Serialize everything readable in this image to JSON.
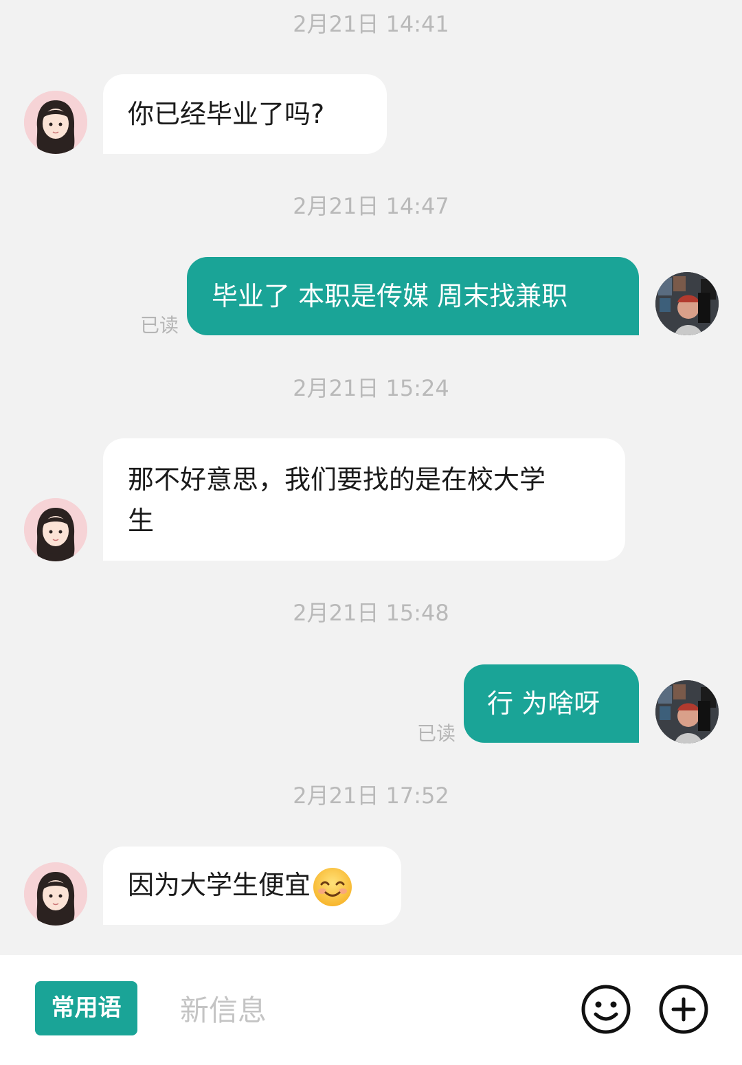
{
  "messages": [
    {
      "time": "2月21日 14:41",
      "text": "你已经毕业了吗?"
    },
    {
      "time": "2月21日 14:47",
      "text": "毕业了  本职是传媒  周末找兼职",
      "status": "已读"
    },
    {
      "time": "2月21日 15:24",
      "text_line1": "那不好意思，我们要找的是在校大学",
      "text_line2": "生"
    },
    {
      "time": "2月21日 15:48",
      "text": "行  为啥呀",
      "status": "已读"
    },
    {
      "time": "2月21日 17:52",
      "text": "因为大学生便宜",
      "emoji": "smiling-face-emoji"
    }
  ],
  "composer": {
    "phrase_label": "常用语",
    "placeholder": "新信息",
    "emoji_icon": "smiley-icon",
    "add_icon": "plus-circle-icon"
  },
  "colors": {
    "accent": "#1aa497",
    "background": "#f2f2f2",
    "incoming_bubble": "#ffffff",
    "timestamp": "#b9b9b9"
  }
}
